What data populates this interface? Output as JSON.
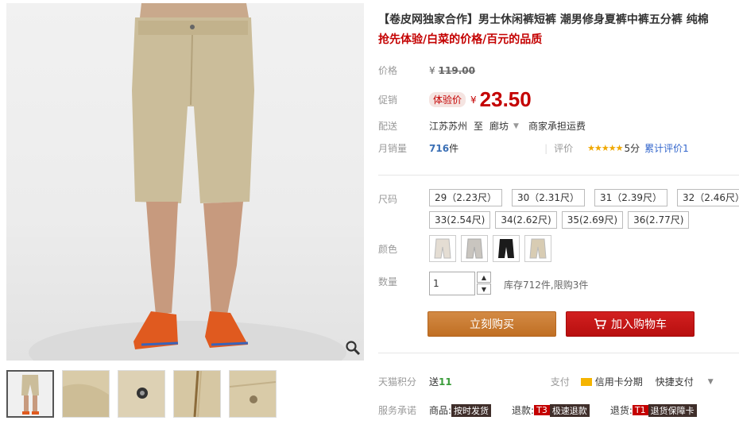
{
  "product": {
    "title": "【卷皮网独家合作】男士休闲裤短裤 潮男修身夏裤中裤五分裤 纯棉",
    "subtitle": "抢先体验/白菜的价格/百元的品质"
  },
  "price": {
    "label": "价格",
    "currency": "¥",
    "original": "119.00"
  },
  "promo": {
    "label": "促销",
    "badge": "体验价",
    "currency": "¥",
    "price": "23.50"
  },
  "shipping": {
    "label": "配送",
    "from": "江苏苏州",
    "to_word": "至",
    "dest": "廊坊",
    "fee": "商家承担运费"
  },
  "sales": {
    "label": "月销量",
    "count": "716",
    "unit": "件",
    "rating_label": "评价",
    "stars": 5,
    "score": "5分",
    "total": "累计评价1"
  },
  "size": {
    "label": "尺码",
    "options": [
      "29（2.23尺）",
      "30（2.31尺）",
      "31（2.39尺）",
      "32（2.46尺）",
      "33(2.54尺)",
      "34(2.62尺)",
      "35(2.69尺)",
      "36(2.77尺)"
    ]
  },
  "color": {
    "label": "颜色",
    "swatches": [
      "#e4ddd3",
      "#c9c5bf",
      "#1b1b1b",
      "#d8ccb3"
    ]
  },
  "quantity": {
    "label": "数量",
    "value": "1",
    "stock": "库存712件,限购3件"
  },
  "buttons": {
    "buy": "立刻购买",
    "cart": "加入购物车"
  },
  "points": {
    "label": "天猫积分",
    "prefix": "送",
    "value": "11",
    "pay_label": "支付",
    "card": "信用卡分期",
    "quick": "快捷支付"
  },
  "service": {
    "label": "服务承诺",
    "goods": "商品:",
    "goods_tag": "按时发货",
    "refund": "退款:",
    "refund_code": "T3",
    "refund_tag": "极速退款",
    "return": "退货:",
    "return_code": "T1",
    "return_tag": "退货保障卡"
  },
  "colors": {
    "accent": "#c40000",
    "buy": "#c8792f",
    "cart": "#c81818"
  }
}
